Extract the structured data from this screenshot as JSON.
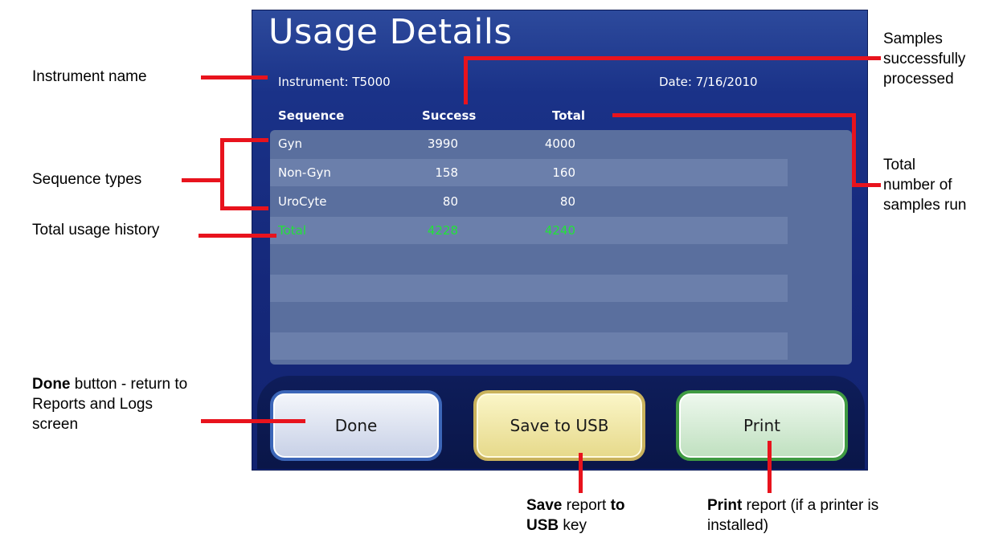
{
  "screen": {
    "title": "Usage Details",
    "instrument": "Instrument: T5000",
    "date": "Date: 7/16/2010",
    "columns": [
      "Sequence",
      "Success",
      "Total"
    ],
    "rows": [
      {
        "sequence": "Gyn",
        "success": "3990",
        "total": "4000"
      },
      {
        "sequence": "Non-Gyn",
        "success": "158",
        "total": "160"
      },
      {
        "sequence": "UroCyte",
        "success": "80",
        "total": "80"
      },
      {
        "sequence": "Total",
        "success": "4228",
        "total": "4240"
      }
    ],
    "buttons": {
      "done": "Done",
      "save_usb": "Save to USB",
      "print": "Print"
    }
  },
  "callouts": {
    "instrument_name": "Instrument name",
    "sequence_types": "Sequence types",
    "total_usage": "Total usage history",
    "done_bold": "Done",
    "done_line1_rest": " button - return to",
    "done_line2": "Reports and Logs",
    "done_line3": "screen",
    "samples_line1": "Samples",
    "samples_line2": "successfully",
    "samples_line3": "processed",
    "total_line1": "Total",
    "total_line2": "number of",
    "total_line3": "samples run",
    "save_bold1": "Save",
    "save_mid": " report ",
    "save_bold2": "to",
    "save_bold3": "USB",
    "save_end": " key",
    "print_bold": "Print",
    "print_line1_rest": " report (if a printer is",
    "print_line2": "installed)"
  },
  "colors": {
    "callout_line": "#e8131d",
    "total_row_text": "#23e23a",
    "screen_bg": "#1a3288"
  }
}
